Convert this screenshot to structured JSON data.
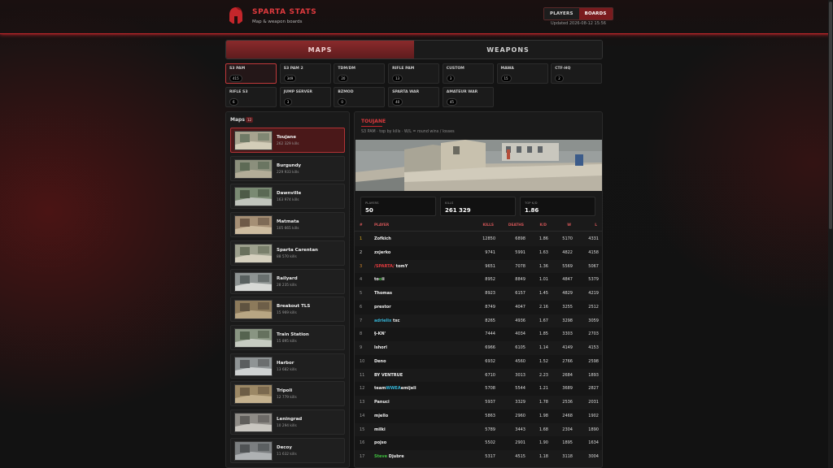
{
  "header": {
    "brand": "SPARTA STATS",
    "subtitle": "Map & weapon boards",
    "nav": [
      "PLAYERS",
      "BOARDS"
    ],
    "updated": "Updated 2026-08-12 15:56",
    "accent": "#c4262b"
  },
  "tabs": [
    "MAPS",
    "WEAPONS"
  ],
  "categories": [
    {
      "name": "S3 PAM",
      "count": "415",
      "active": true
    },
    {
      "name": "S3 PAM 2",
      "count": "349"
    },
    {
      "name": "TDM/DM",
      "count": "20"
    },
    {
      "name": "RIFLE PAM",
      "count": "13"
    },
    {
      "name": "CUSTOM",
      "count": "3"
    },
    {
      "name": "MAWA",
      "count": "15"
    },
    {
      "name": "CTF-HQ",
      "count": "2"
    },
    {
      "name": "RIFLE S3",
      "count": "6"
    },
    {
      "name": "JUMP SERVER",
      "count": "3"
    },
    {
      "name": "BZMOD",
      "count": "0"
    },
    {
      "name": "SPARTA WAR",
      "count": "40"
    },
    {
      "name": "AMATEUR WAR",
      "count": "45"
    }
  ],
  "maps_panel": {
    "title": "Maps",
    "count": "12",
    "items": [
      {
        "name": "Toujane",
        "kills": "262 329 kills",
        "active": true
      },
      {
        "name": "Burgundy",
        "kills": "229 933 kills"
      },
      {
        "name": "Dawnville",
        "kills": "163 974 kills"
      },
      {
        "name": "Matmata",
        "kills": "105 665 kills"
      },
      {
        "name": "Sparta Carentan",
        "kills": "88 570 kills"
      },
      {
        "name": "Railyard",
        "kills": "28 235 kills"
      },
      {
        "name": "Breakout TLS",
        "kills": "15 969 kills"
      },
      {
        "name": "Train Station",
        "kills": "15 895 kills"
      },
      {
        "name": "Harbor",
        "kills": "13 682 kills"
      },
      {
        "name": "Tripoli",
        "kills": "12 779 kills"
      },
      {
        "name": "Leningrad",
        "kills": "10 294 kills"
      },
      {
        "name": "Decoy",
        "kills": "11 632 kills"
      }
    ]
  },
  "detail": {
    "title": "TOUJANE",
    "subtitle": "S3 PAM · top by kills · W/L = round wins / losses",
    "stats": [
      {
        "label": "PLAYERS",
        "value": "50"
      },
      {
        "label": "KILLS",
        "value": "261 329"
      },
      {
        "label": "TOP K/D",
        "value": "1.86"
      }
    ],
    "columns": [
      "#",
      "PLAYER",
      "KILLS",
      "DEATHS",
      "K/D",
      "W",
      "L"
    ],
    "rank_colors": [
      "#e3b21c",
      "#d8d8d8",
      "#d58a2c"
    ],
    "rows": [
      {
        "rank": "1",
        "player": [
          "Zofkich"
        ],
        "kills": "12850",
        "deaths": "6898",
        "kd": "1.86",
        "w": "5170",
        "l": "4331"
      },
      {
        "rank": "2",
        "player": [
          "zxjerko"
        ],
        "kills": "9741",
        "deaths": "5991",
        "kd": "1.63",
        "w": "4822",
        "l": "4158"
      },
      {
        "rank": "3",
        "player": [
          "/SPARTA/",
          "tomY"
        ],
        "pcolors": [
          "#e03a3e",
          "#eeeeee"
        ],
        "kills": "9651",
        "deaths": "7078",
        "kd": "1.36",
        "w": "5569",
        "l": "5067"
      },
      {
        "rank": "4",
        "player": [
          "to",
          "o",
          "ii"
        ],
        "pcolors": [
          "#eeeeee",
          "#3fbf3f",
          "#eeeeee"
        ],
        "kills": "8952",
        "deaths": "8849",
        "kd": "1.01",
        "w": "4847",
        "l": "5379"
      },
      {
        "rank": "5",
        "player": [
          "Thomas"
        ],
        "kills": "8923",
        "deaths": "6157",
        "kd": "1.45",
        "w": "4829",
        "l": "4219"
      },
      {
        "rank": "6",
        "player": [
          "prestor"
        ],
        "kills": "8749",
        "deaths": "4047",
        "kd": "2.16",
        "w": "3255",
        "l": "2512"
      },
      {
        "rank": "7",
        "player": [
          "adrielix",
          "txc"
        ],
        "pcolors": [
          "#35b4d6",
          "#eeeeee"
        ],
        "kills": "8265",
        "deaths": "4936",
        "kd": "1.67",
        "w": "3298",
        "l": "3059"
      },
      {
        "rank": "8",
        "player": [
          "§-KN'"
        ],
        "kills": "7444",
        "deaths": "4034",
        "kd": "1.85",
        "w": "3303",
        "l": "2703"
      },
      {
        "rank": "9",
        "player": [
          "lshorl"
        ],
        "kills": "6966",
        "deaths": "6105",
        "kd": "1.14",
        "w": "4149",
        "l": "4153"
      },
      {
        "rank": "10",
        "player": [
          "Deno"
        ],
        "kills": "6932",
        "deaths": "4560",
        "kd": "1.52",
        "w": "2766",
        "l": "2598"
      },
      {
        "rank": "11",
        "player": [
          "BY VENTRUE"
        ],
        "kills": "6710",
        "deaths": "3013",
        "kd": "2.23",
        "w": "2684",
        "l": "1893"
      },
      {
        "rank": "12",
        "player": [
          "team",
          "WWEA",
          "emijeli"
        ],
        "pcolors": [
          "#eeeeee",
          "#35b4d6",
          "#eeeeee"
        ],
        "kills": "5708",
        "deaths": "5544",
        "kd": "1.21",
        "w": "3689",
        "l": "2827"
      },
      {
        "rank": "13",
        "player": [
          "Panuci"
        ],
        "kills": "5937",
        "deaths": "3329",
        "kd": "1.78",
        "w": "2536",
        "l": "2031"
      },
      {
        "rank": "14",
        "player": [
          "mjello"
        ],
        "kills": "5863",
        "deaths": "2960",
        "kd": "1.98",
        "w": "2468",
        "l": "1902"
      },
      {
        "rank": "15",
        "player": [
          "milki"
        ],
        "kills": "5789",
        "deaths": "3443",
        "kd": "1.68",
        "w": "2304",
        "l": "1890"
      },
      {
        "rank": "16",
        "player": [
          "pojso"
        ],
        "kills": "5502",
        "deaths": "2901",
        "kd": "1.90",
        "w": "1895",
        "l": "1634"
      },
      {
        "rank": "17",
        "player": [
          "Steve",
          "Djubre"
        ],
        "pcolors": [
          "#3fbf3f",
          "#eeeeee"
        ],
        "kills": "5317",
        "deaths": "4515",
        "kd": "1.18",
        "w": "3118",
        "l": "3004"
      }
    ]
  }
}
